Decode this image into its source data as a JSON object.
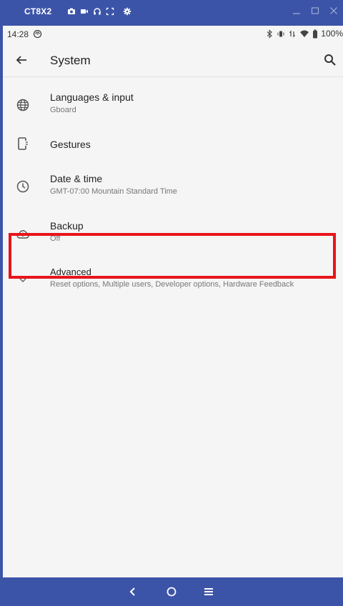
{
  "emulator": {
    "device_name": "CT8X2",
    "toolbar_icons": [
      "camera-icon",
      "video-icon",
      "headphones-icon",
      "fullscreen-icon",
      "settings-icon"
    ],
    "window_controls": [
      "minimize-icon",
      "maximize-icon",
      "close-icon"
    ]
  },
  "status_bar": {
    "time": "14:28",
    "battery": "100%",
    "icons": [
      "sync-icon",
      "bluetooth-icon",
      "vibrate-icon",
      "data-arrows-icon",
      "wifi-icon",
      "battery-icon"
    ]
  },
  "app_bar": {
    "title": "System",
    "back_icon": "arrow-back-icon",
    "search_icon": "search-icon"
  },
  "items": [
    {
      "icon": "globe-icon",
      "title": "Languages & input",
      "subtitle": "Gboard"
    },
    {
      "icon": "gestures-icon",
      "title": "Gestures",
      "subtitle": ""
    },
    {
      "icon": "clock-icon",
      "title": "Date & time",
      "subtitle": "GMT-07:00 Mountain Standard Time"
    },
    {
      "icon": "cloud-upload-icon",
      "title": "Backup",
      "subtitle": "Off"
    },
    {
      "icon": "chevron-down-icon",
      "title": "Advanced",
      "subtitle": "Reset options, Multiple users, Developer options, Hardware Feedback"
    }
  ],
  "highlight_color": "#e8141a",
  "nav_bar": {
    "buttons": [
      "nav-back-icon",
      "nav-home-icon",
      "nav-menu-icon"
    ]
  },
  "colors": {
    "frame": "#3c54a8",
    "screen_bg": "#f5f5f5"
  }
}
